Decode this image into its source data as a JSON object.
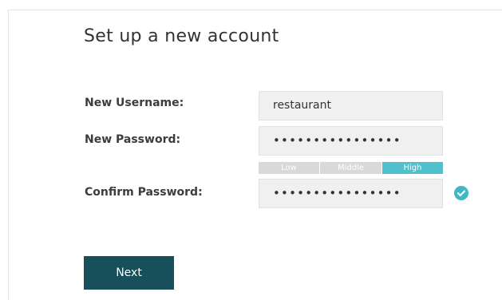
{
  "page": {
    "title": "Set up a new account"
  },
  "form": {
    "username": {
      "label": "New Username:",
      "value": "restaurant"
    },
    "password": {
      "label": "New Password:",
      "value": "••••••••••••••••"
    },
    "strength": {
      "low_label": "Low",
      "middle_label": "Middle",
      "high_label": "High",
      "level": "High",
      "active_color": "#4fc0cc",
      "inactive_color": "#d9d9d9"
    },
    "confirm": {
      "label": "Confirm Password:",
      "value": "••••••••••••••••",
      "status_icon": "check-circle-icon",
      "status_color": "#3fb7c4"
    }
  },
  "actions": {
    "next_label": "Next",
    "button_color": "#17505a"
  }
}
